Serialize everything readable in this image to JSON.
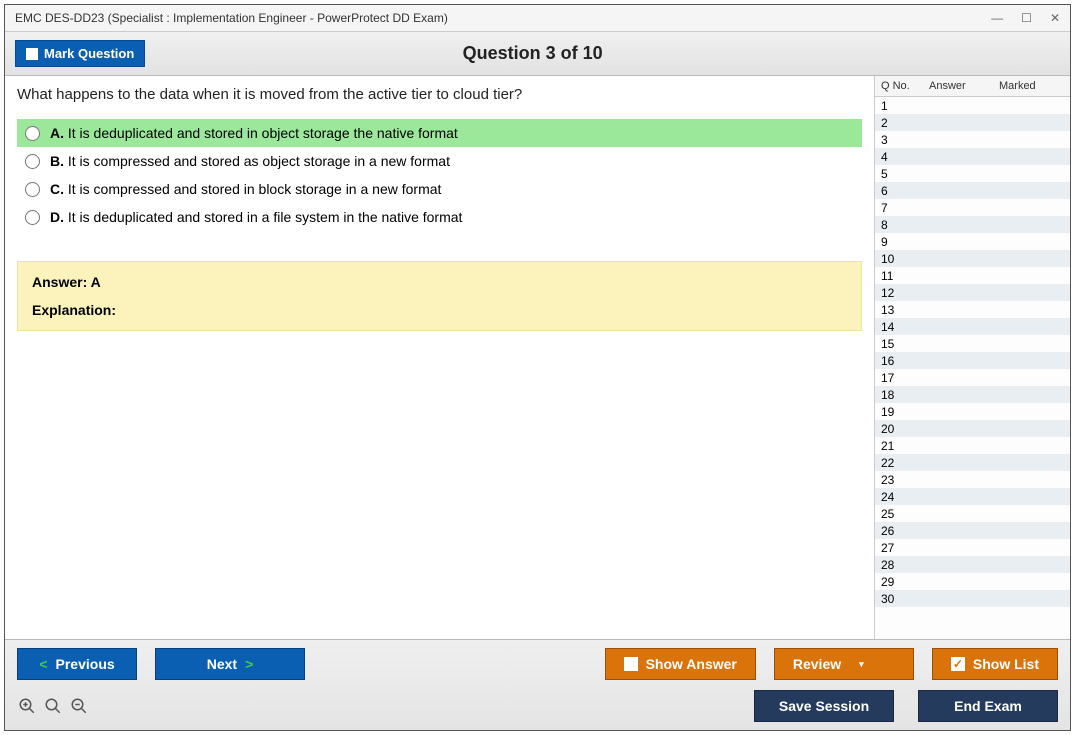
{
  "window": {
    "title": "EMC DES-DD23 (Specialist : Implementation Engineer - PowerProtect DD Exam)"
  },
  "header": {
    "mark_label": "Mark Question",
    "counter": "Question 3 of 10"
  },
  "question": {
    "text": "What happens to the data when it is moved from the active tier to cloud tier?",
    "options": [
      {
        "letter": "A.",
        "text": "It is deduplicated and stored in object storage the native format",
        "selected": true
      },
      {
        "letter": "B.",
        "text": "It is compressed and stored as object storage in a new format",
        "selected": false
      },
      {
        "letter": "C.",
        "text": "It is compressed and stored in block storage in a new format",
        "selected": false
      },
      {
        "letter": "D.",
        "text": "It is deduplicated and stored in a file system in the native format",
        "selected": false
      }
    ]
  },
  "answer_box": {
    "answer_line": "Answer: A",
    "explanation_label": "Explanation:"
  },
  "sidebar": {
    "headers": {
      "qno": "Q No.",
      "answer": "Answer",
      "marked": "Marked"
    },
    "rows": [
      1,
      2,
      3,
      4,
      5,
      6,
      7,
      8,
      9,
      10,
      11,
      12,
      13,
      14,
      15,
      16,
      17,
      18,
      19,
      20,
      21,
      22,
      23,
      24,
      25,
      26,
      27,
      28,
      29,
      30
    ]
  },
  "footer": {
    "previous": "Previous",
    "next": "Next",
    "show_answer": "Show Answer",
    "review": "Review",
    "show_list": "Show List",
    "save_session": "Save Session",
    "end_exam": "End Exam"
  }
}
